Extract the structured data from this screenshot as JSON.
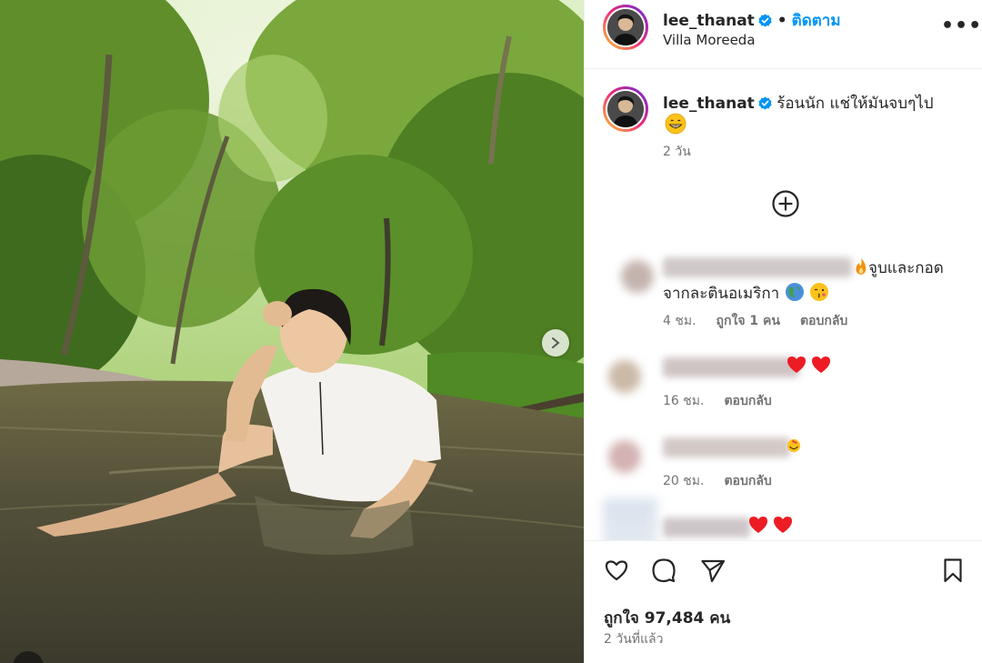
{
  "post": {
    "username": "lee_thanat",
    "follow_label": "ติดตาม",
    "separator": "•",
    "location": "Villa Moreeda",
    "more_label": "•••"
  },
  "caption": {
    "username": "lee_thanat",
    "text": "ร้อนนัก แช่ให้มันจบๆไป",
    "time": "2 วัน"
  },
  "comments": [
    {
      "text_line1": "จูบและกอด",
      "text_line2": "จากละตินอเมริกา",
      "time": "4 ชม.",
      "likes": "ถูกใจ 1 คน",
      "reply": "ตอบกลับ"
    },
    {
      "text_line1": "",
      "time": "16 ชม.",
      "reply": "ตอบกลับ"
    },
    {
      "text_line1": "",
      "time": "20 ชม.",
      "reply": "ตอบกลับ"
    },
    {
      "text_line1": "",
      "time": "",
      "reply": ""
    }
  ],
  "footer": {
    "likes": "ถูกใจ 97,484 คน",
    "posted": "2 วันที่แล้ว"
  },
  "colors": {
    "link_blue": "#0095f6",
    "verified_blue": "#0095f6",
    "heart_red": "#ed1c24"
  },
  "icons": [
    "verified-badge-icon",
    "more-icon",
    "add-circle-icon",
    "heart-icon",
    "comment-icon",
    "share-icon",
    "bookmark-icon",
    "chevron-right-icon"
  ]
}
